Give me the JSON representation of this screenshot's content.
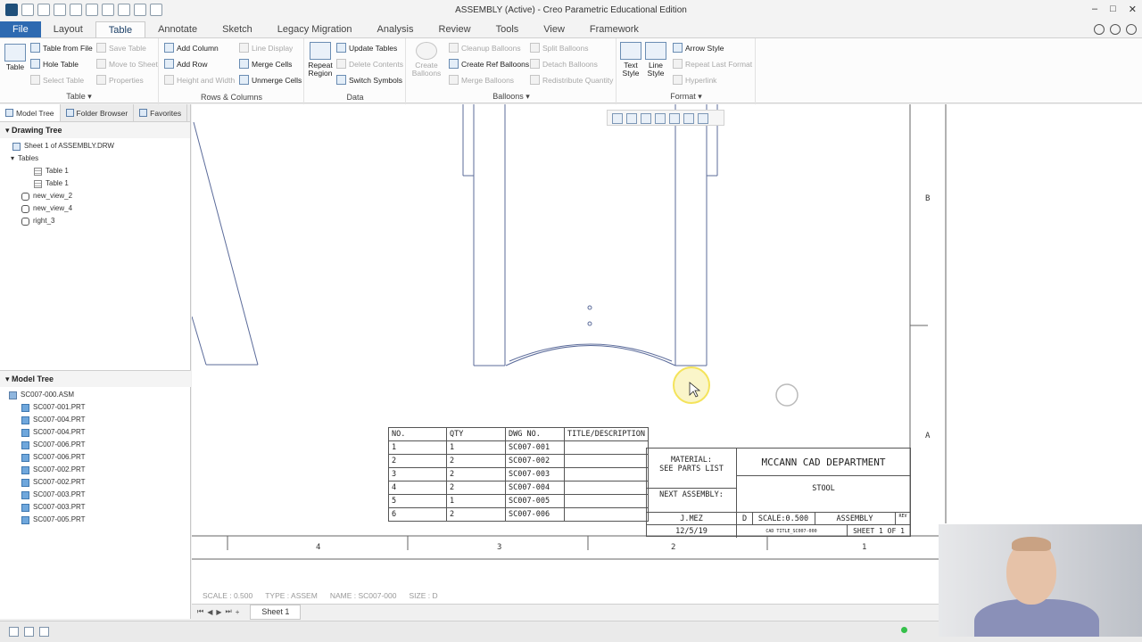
{
  "window": {
    "title": "ASSEMBLY (Active) - Creo Parametric Educational Edition",
    "controls": [
      "–",
      "□",
      "✕"
    ]
  },
  "tabs": [
    "File",
    "Layout",
    "Table",
    "Annotate",
    "Sketch",
    "Legacy Migration",
    "Analysis",
    "Review",
    "Tools",
    "View",
    "Framework"
  ],
  "active_tab": "Table",
  "ribbon": {
    "table_group": {
      "label": "Table ▾",
      "big": "Table",
      "items": [
        "Table from File",
        "Save Table",
        "Hole Table",
        "Move to Sheet",
        "Select Table",
        "Properties"
      ]
    },
    "rows_columns": {
      "label": "Rows & Columns",
      "items": [
        "Add Column",
        "Line Display",
        "Add Row",
        "Merge Cells",
        "Height and Width",
        "Unmerge Cells"
      ]
    },
    "data": {
      "label": "Data",
      "big": "Repeat Region",
      "items": [
        "Update Tables",
        "Delete Contents",
        "Switch Symbols"
      ]
    },
    "balloons": {
      "label": "Balloons ▾",
      "big": "Create Balloons",
      "items": [
        "Cleanup Balloons",
        "Split Balloons",
        "Create Ref Balloons",
        "Detach Balloons",
        "Merge Balloons",
        "Redistribute Quantity"
      ]
    },
    "format": {
      "label": "Format ▾",
      "big1": "Text Style",
      "big2": "Line Style",
      "items": [
        "Arrow Style",
        "Repeat Last Format",
        "Hyperlink"
      ]
    }
  },
  "left_panel": {
    "tabs": [
      "Model Tree",
      "Folder Browser",
      "Favorites"
    ],
    "drawing_tree": {
      "title": "Drawing Tree",
      "items": [
        "Sheet 1 of ASSEMBLY.DRW",
        "Tables",
        "Table 1",
        "Table 1",
        "new_view_2",
        "new_view_4",
        "right_3"
      ]
    },
    "model_tree": {
      "title": "Model Tree",
      "items": [
        "SC007-000.ASM",
        "SC007-001.PRT",
        "SC007-004.PRT",
        "SC007-004.PRT",
        "SC007-006.PRT",
        "SC007-006.PRT",
        "SC007-002.PRT",
        "SC007-002.PRT",
        "SC007-003.PRT",
        "SC007-003.PRT",
        "SC007-005.PRT"
      ]
    }
  },
  "drawing": {
    "bom_headers": [
      "NO.",
      "QTY",
      "DWG NO.",
      "TITLE/DESCRIPTION"
    ],
    "bom_rows": [
      [
        "1",
        "1",
        "SC007-001",
        ""
      ],
      [
        "2",
        "2",
        "SC007-002",
        ""
      ],
      [
        "3",
        "2",
        "SC007-003",
        ""
      ],
      [
        "4",
        "2",
        "SC007-004",
        ""
      ],
      [
        "5",
        "1",
        "SC007-005",
        ""
      ],
      [
        "6",
        "2",
        "SC007-006",
        ""
      ]
    ],
    "title_block": {
      "material": "MATERIAL:",
      "material2": "SEE PARTS LIST",
      "department": "MCCANN CAD DEPARTMENT",
      "part": "STOOL",
      "next_assembly": "NEXT ASSEMBLY:",
      "drawn_by": "J.MEZ",
      "size": "D",
      "scale": "SCALE:0.500",
      "name": "ASSEMBLY",
      "rev": "REV",
      "date": "12/5/19",
      "file": "CAD TITLE_SC007-000",
      "sheet": "SHEET 1 OF 1"
    },
    "border_cols": [
      "4",
      "3",
      "2",
      "1"
    ],
    "border_rows": [
      "B",
      "A"
    ],
    "status": [
      "SCALE : 0.500",
      "TYPE : ASSEM",
      "NAME : SC007-000",
      "SIZE : D"
    ]
  },
  "sheet_tab": "Sheet 1",
  "colors": {
    "file_tab": "#2e6ab1",
    "line": "#555555",
    "cursor_highlight": "#f3e14a"
  }
}
